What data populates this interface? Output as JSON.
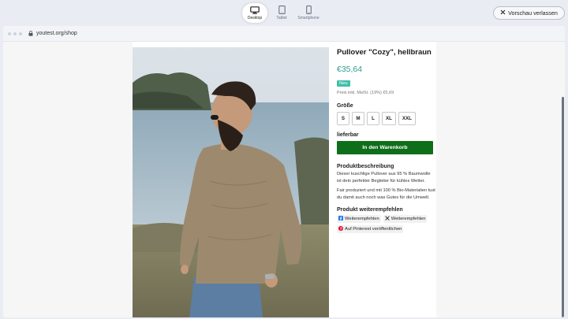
{
  "preview": {
    "devices": [
      {
        "label": "Desktop",
        "icon": "desktop-icon",
        "active": true
      },
      {
        "label": "Tablet",
        "icon": "tablet-icon",
        "active": false
      },
      {
        "label": "Smartphone",
        "icon": "smartphone-icon",
        "active": false
      }
    ],
    "exit_label": "Vorschau verlassen"
  },
  "browser": {
    "url": "youtest.org/shop"
  },
  "product": {
    "title": "Pullover \"Cozy\", hellbraun",
    "price": "€35,64",
    "badge": "Neu",
    "tax_note": "Preis inkl. MwSt. (19%) €5,69",
    "size_label": "Größe",
    "sizes": [
      "S",
      "M",
      "L",
      "XL",
      "XXL"
    ],
    "availability": "lieferbar",
    "cart_button": "In den Warenkorb",
    "description_heading": "Produktbeschreibung",
    "description_1": "Dieser kuschlige Pullover aus 95 % Baumwolle ist dein perfekter Begleiter für kühles Wetter.",
    "description_2": "Fair produziert und mit 100 % Bio-Materialien tust du damit auch noch was Gutes für die Umwelt.",
    "share_heading": "Produkt weiterempfehlen",
    "share": {
      "facebook": "Weiterempfehlen",
      "x": "Weiterempfehlen",
      "pinterest": "Auf Pinterest veröffentlichen"
    }
  },
  "colors": {
    "price": "#2a9d8f",
    "badge": "#3fbfa8",
    "cart_button": "#0f6e1a",
    "facebook": "#1877f2",
    "pinterest": "#e60023"
  }
}
